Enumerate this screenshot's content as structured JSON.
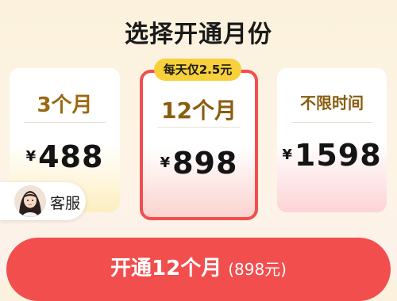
{
  "header": {
    "title": "选择开通月份"
  },
  "plans": [
    {
      "name": "3个月",
      "currency": "¥",
      "price": "488"
    },
    {
      "name": "12个月",
      "currency": "¥",
      "price": "898",
      "badge": "每天仅2.5元",
      "selected": true
    },
    {
      "name": "不限时间",
      "currency": "¥",
      "price": "1598"
    }
  ],
  "service": {
    "label": "客服",
    "avatar_icon": "customer-service-avatar-icon"
  },
  "cta": {
    "main": "开通12个月",
    "sub": "(898元)"
  },
  "colors": {
    "accent": "#f24e4e",
    "badge": "#f7d03a",
    "plan_name": "#9a6a12"
  }
}
